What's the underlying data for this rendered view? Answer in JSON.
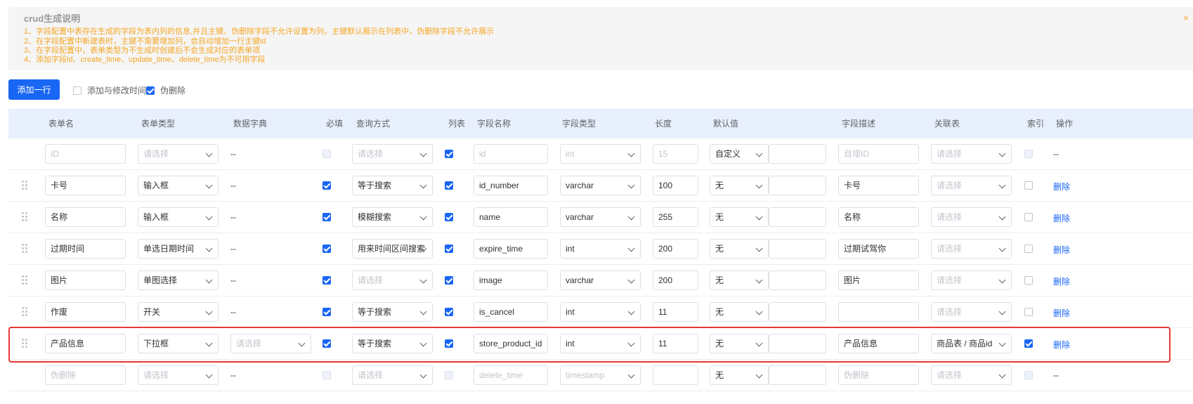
{
  "notice": {
    "title": "crud生成说明",
    "lines": [
      "1、字段配置中表存在生成的字段为表内列的信息,并且主键、伪删除字段不允许设置为列，主键默认展示在列表中，伪删除字段不允许展示",
      "2、在字段配置中新建表时，主键不需要增加列，会自动增加一行主键id",
      "3、在字段配置中，表单类型为不生成时创建后不会生成对应的表单项",
      "4、添加字段id、create_time、update_time、delete_time为不可用字段"
    ],
    "close": "×"
  },
  "toolbar": {
    "add_row": "添加一行",
    "timestamps_label": "添加与修改时间",
    "timestamps_checked": false,
    "soft_delete_label": "伪删除",
    "soft_delete_checked": true
  },
  "headers": {
    "form_name": "表单名",
    "form_type": "表单类型",
    "dict": "数据字典",
    "required": "必填",
    "query": "查询方式",
    "list": "列表",
    "field_name": "字段名称",
    "field_type": "字段类型",
    "length": "长度",
    "default": "默认值",
    "desc": "字段描述",
    "relation": "关联表",
    "index": "索引",
    "action": "操作"
  },
  "placeholder": "请选择",
  "delete_label": "删除",
  "rows": [
    {
      "form_name": "ID",
      "form_name_ph": true,
      "form_type": "请选择",
      "form_type_ph": true,
      "dict": "--",
      "required": false,
      "required_disabled": true,
      "query": "请选择",
      "query_ph": true,
      "list": true,
      "field_name": "id",
      "field_name_ph": true,
      "field_type": "int",
      "field_type_ph": true,
      "length": "15",
      "length_ph": true,
      "default_mode": "自定义",
      "default_value": "",
      "desc": "自增ID",
      "desc_ph": true,
      "relation": "请选择",
      "relation_ph": true,
      "index": false,
      "index_disabled": true,
      "action": "--",
      "draggable": false
    },
    {
      "form_name": "卡号",
      "form_type": "输入框",
      "dict": "--",
      "required": true,
      "query": "等于搜索",
      "list": true,
      "field_name": "id_number",
      "field_type": "varchar",
      "length": "100",
      "default_mode": "无",
      "default_value": "",
      "desc": "卡号",
      "relation": "请选择",
      "relation_ph": true,
      "index": false,
      "action": "删除",
      "draggable": true
    },
    {
      "form_name": "名称",
      "form_type": "输入框",
      "dict": "--",
      "required": true,
      "query": "模糊搜索",
      "list": true,
      "field_name": "name",
      "field_type": "varchar",
      "length": "255",
      "default_mode": "无",
      "default_value": "",
      "desc": "名称",
      "relation": "请选择",
      "relation_ph": true,
      "index": false,
      "action": "删除",
      "draggable": true
    },
    {
      "form_name": "过期时间",
      "form_type": "单选日期时间",
      "dict": "--",
      "required": true,
      "query": "用来时间区间搜索",
      "list": true,
      "field_name": "expire_time",
      "field_type": "int",
      "length": "200",
      "default_mode": "无",
      "default_value": "",
      "desc": "过期试驾你",
      "relation": "请选择",
      "relation_ph": true,
      "index": false,
      "action": "删除",
      "draggable": true
    },
    {
      "form_name": "图片",
      "form_type": "单图选择",
      "dict": "--",
      "required": true,
      "query": "请选择",
      "query_ph": true,
      "list": true,
      "field_name": "image",
      "field_type": "varchar",
      "length": "200",
      "default_mode": "无",
      "default_value": "",
      "desc": "图片",
      "relation": "请选择",
      "relation_ph": true,
      "index": false,
      "action": "删除",
      "draggable": true
    },
    {
      "form_name": "作废",
      "form_type": "开关",
      "dict": "--",
      "required": true,
      "query": "等于搜索",
      "list": true,
      "field_name": "is_cancel",
      "field_type": "int",
      "length": "11",
      "default_mode": "无",
      "default_value": "",
      "desc": "",
      "relation": "请选择",
      "relation_ph": true,
      "index": false,
      "action": "删除",
      "draggable": true
    },
    {
      "form_name": "产品信息",
      "form_type": "下拉框",
      "dict": "请选择",
      "dict_select": true,
      "required": true,
      "query": "等于搜索",
      "list": true,
      "field_name": "store_product_id",
      "field_type": "int",
      "length": "11",
      "default_mode": "无",
      "default_value": "",
      "desc": "产品信息",
      "relation": "商品表 / 商品id",
      "index": true,
      "action": "删除",
      "draggable": true,
      "highlighted": true
    },
    {
      "form_name": "伪删除",
      "form_name_ph": true,
      "form_type": "请选择",
      "form_type_ph": true,
      "dict": "--",
      "required": false,
      "required_disabled": true,
      "query": "请选择",
      "query_ph": true,
      "list": false,
      "list_disabled": true,
      "field_name": "delete_time",
      "field_name_ph": true,
      "field_type": "timestamp",
      "field_type_ph": true,
      "length": "",
      "default_mode": "无",
      "default_value": "",
      "desc": "伪删除",
      "desc_ph": true,
      "relation": "请选择",
      "relation_ph": true,
      "index": false,
      "index_disabled": true,
      "action": "--",
      "draggable": false
    }
  ]
}
